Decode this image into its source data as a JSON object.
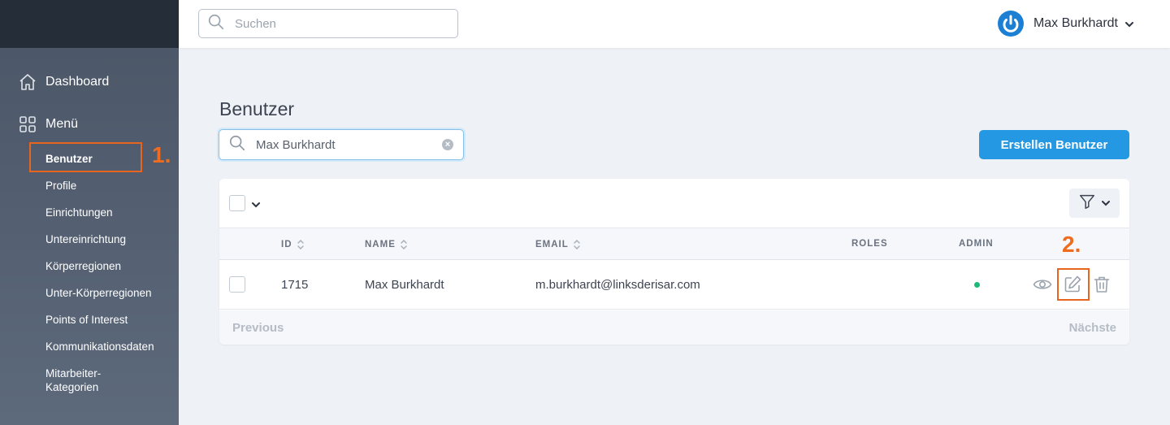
{
  "sidebar": {
    "items": [
      {
        "label": "Dashboard",
        "icon": "home-icon"
      },
      {
        "label": "Menü",
        "icon": "grid-icon"
      }
    ],
    "subitems": [
      {
        "label": "Benutzer",
        "active": true
      },
      {
        "label": "Profile"
      },
      {
        "label": "Einrichtungen"
      },
      {
        "label": "Untereinrichtung"
      },
      {
        "label": "Körperregionen"
      },
      {
        "label": "Unter-Körperregionen"
      },
      {
        "label": "Points of Interest"
      },
      {
        "label": "Kommunikationsdaten"
      },
      {
        "label": "Mitarbeiter-\nKategorien"
      }
    ]
  },
  "annotations": {
    "step1": "1.",
    "step2": "2.",
    "color": "#e8651f"
  },
  "header": {
    "search_placeholder": "Suchen",
    "user_name": "Max Burkhardt"
  },
  "main": {
    "title": "Benutzer",
    "search_value": "Max Burkhardt",
    "create_button": "Erstellen Benutzer"
  },
  "table": {
    "columns": {
      "id": "ID",
      "name": "NAME",
      "email": "EMAIL",
      "roles": "ROLES",
      "admin": "ADMIN"
    },
    "rows": [
      {
        "id": "1715",
        "name": "Max Burkhardt",
        "email": "m.burkhardt@linksderisar.com",
        "roles": "",
        "admin": true
      }
    ],
    "pager": {
      "previous": "Previous",
      "next": "Nächste"
    }
  },
  "colors": {
    "accent": "#2598e4",
    "sidebar_top": "#252d38",
    "admin_true": "#1cb978"
  }
}
